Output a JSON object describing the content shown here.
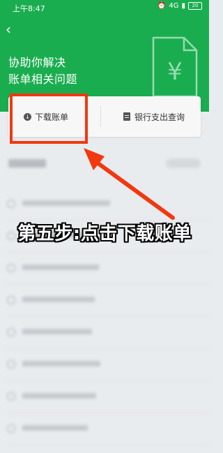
{
  "status_bar": {
    "time": "上午8:47",
    "network": "4G",
    "battery": "20"
  },
  "header": {
    "back_icon": "chevron-left-icon",
    "hero_line1": "协助你解决",
    "hero_line2": "账单相关问题",
    "illustration_icon": "yuan-document-icon",
    "illustration_symbol": "¥"
  },
  "actions": {
    "download": {
      "label": "下载账单",
      "icon": "download-icon"
    },
    "bank_query": {
      "label": "银行支出查询",
      "icon": "document-icon"
    }
  },
  "list": {
    "row_count": 8
  },
  "annotation": {
    "caption": "第五步:点击下载账单",
    "highlight_color": "#f2380f"
  },
  "colors": {
    "brand_green": "#1aad4f",
    "accent_red": "#f2380f"
  }
}
